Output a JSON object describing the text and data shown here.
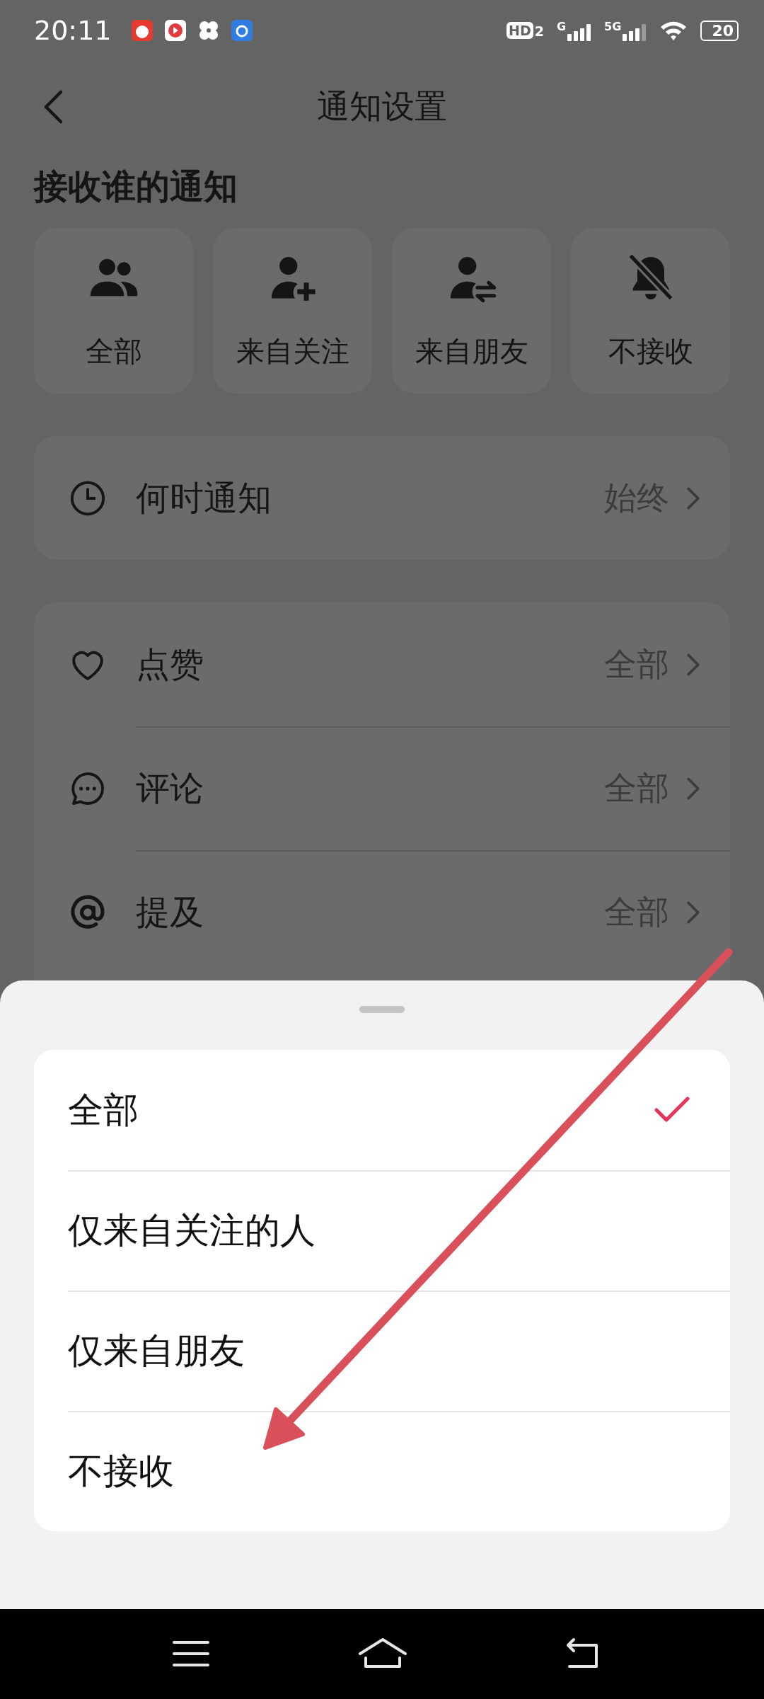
{
  "status_bar": {
    "time": "20:11",
    "hd": "HD",
    "hd_sub": "2",
    "signal_1": "G",
    "signal_2": "5G",
    "battery": "20"
  },
  "header": {
    "title": "通知设置"
  },
  "section_title": "接收谁的通知",
  "sources": [
    {
      "label": "全部"
    },
    {
      "label": "来自关注"
    },
    {
      "label": "来自朋友"
    },
    {
      "label": "不接收"
    }
  ],
  "when": {
    "label": "何时通知",
    "value": "始终"
  },
  "types": [
    {
      "label": "点赞",
      "value": "全部"
    },
    {
      "label": "评论",
      "value": "全部"
    },
    {
      "label": "提及",
      "value": "全部"
    }
  ],
  "sheet": {
    "options": [
      {
        "label": "全部",
        "selected": true
      },
      {
        "label": "仅来自关注的人",
        "selected": false
      },
      {
        "label": "仅来自朋友",
        "selected": false
      },
      {
        "label": "不接收",
        "selected": false
      }
    ]
  },
  "annotation": {
    "kind": "arrow"
  }
}
